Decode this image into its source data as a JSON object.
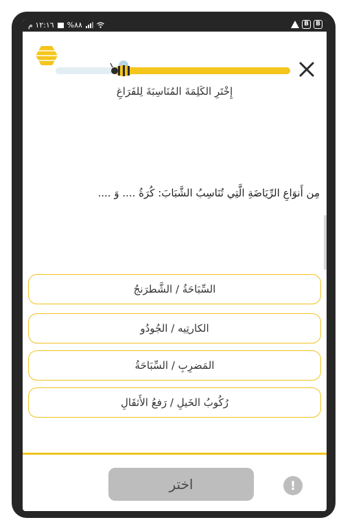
{
  "status_bar": {
    "time": "١٢:١٦ م",
    "battery": "%٨٨",
    "right_icons": [
      "warning-icon",
      "b-icon",
      "b-icon"
    ]
  },
  "progress": {
    "fraction": 0.73,
    "accent": "#f4c51c",
    "track": "#e3eef4"
  },
  "instruction": "إِخْتَرِ الكَلِمَةَ المُنَاسِبَةَ لِلفَرَاغِ",
  "question": "مِن أَنوَاعِ الرِّيَاضَةِ الَّتِي تُنَاسِبُ الشَّبَابَ: كُرَةُ .... وَ ....",
  "options": [
    "السِّبَاحَةُ / الشَّطرَنجُ",
    "الكارتِيه / الجُودُو",
    "المَضرِبِ / السِّبَاحَةُ",
    "رُكُوبُ الخَيلِ / رَفعُ الأَثقَالِ"
  ],
  "submit_label": "اختر",
  "hint_symbol": "!"
}
